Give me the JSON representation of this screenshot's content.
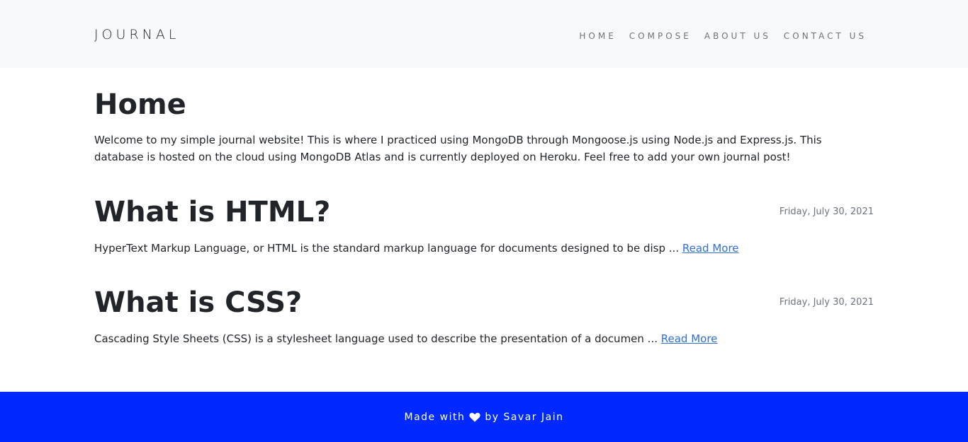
{
  "navbar": {
    "brand": "JOURNAL",
    "links": [
      "HOME",
      "COMPOSE",
      "ABOUT US",
      "CONTACT US"
    ]
  },
  "main": {
    "title": "Home",
    "intro": "Welcome to my simple journal website! This is where I practiced using MongoDB through Mongoose.js using Node.js and Express.js. This database is hosted on the cloud using MongoDB Atlas and is currently deployed on Heroku. Feel free to add your own journal post!",
    "posts": [
      {
        "title": "What is HTML?",
        "date": "Friday, July 30, 2021",
        "excerpt": "HyperText Markup Language, or HTML is the standard markup language for documents designed to be disp ... ",
        "read_more": "Read More"
      },
      {
        "title": "What is CSS?",
        "date": "Friday, July 30, 2021",
        "excerpt": "Cascading Style Sheets (CSS) is a stylesheet language used to describe the presentation of a documen ... ",
        "read_more": "Read More"
      }
    ]
  },
  "footer": {
    "prefix": "Made with",
    "icon": "heart-icon",
    "suffix": "by Savar Jain"
  },
  "colors": {
    "navbar_bg": "#f8f9fa",
    "footer_bg": "#0029ff",
    "link": "#2f6fd6",
    "muted": "#6c757d"
  }
}
